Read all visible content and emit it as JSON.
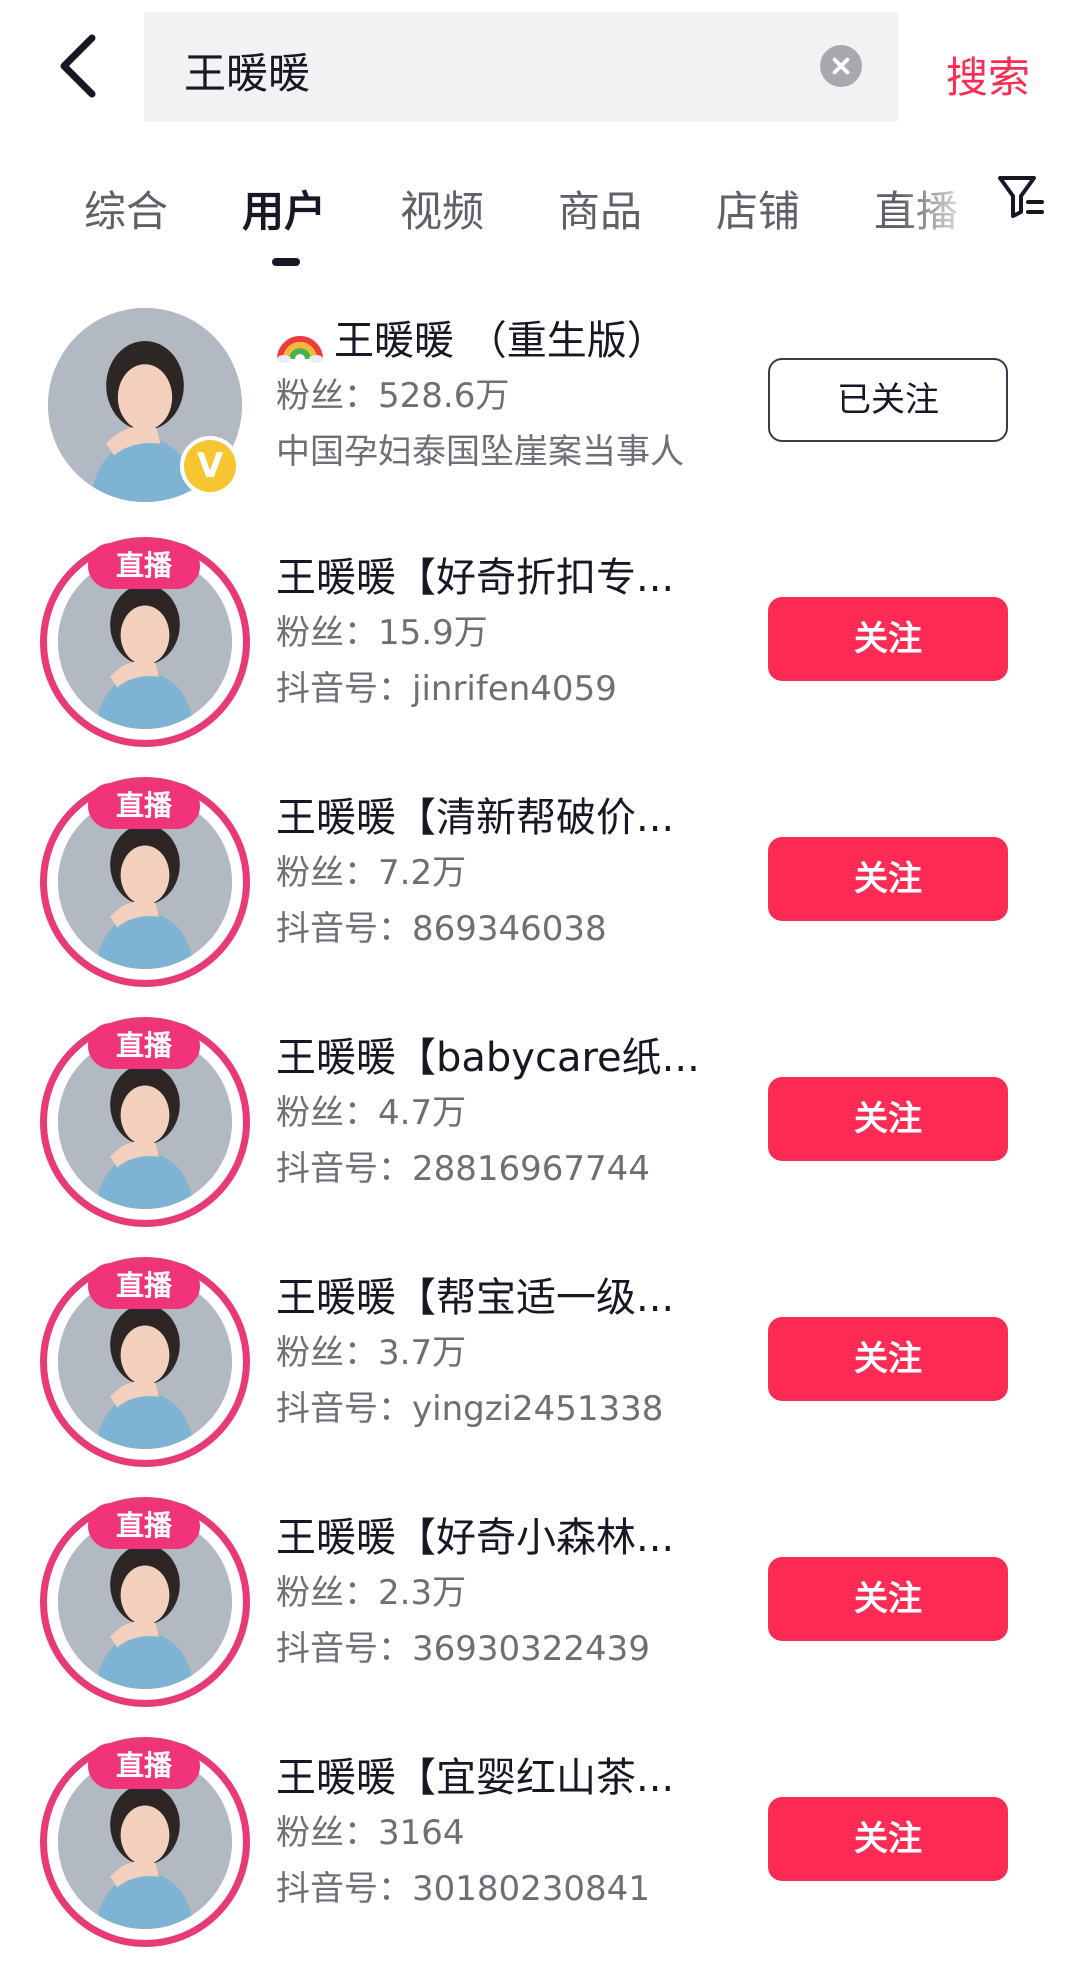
{
  "search": {
    "query": "王暖暖",
    "submit_label": "搜索"
  },
  "tabs": [
    {
      "label": "综合"
    },
    {
      "label": "用户"
    },
    {
      "label": "视频"
    },
    {
      "label": "商品"
    },
    {
      "label": "店铺"
    },
    {
      "label": "直播"
    }
  ],
  "active_tab": "用户",
  "icons": {
    "back": "chevron-left-icon",
    "clear": "clear-icon",
    "filter": "filter-icon",
    "verified": "verified-v-icon",
    "rainbow": "rainbow-emoji-icon"
  },
  "colors": {
    "accent": "#fe2c55",
    "live_ring": "#e93a78",
    "verified": "#f6c52f"
  },
  "users": [
    {
      "name": "王暖暖 （重生版）",
      "fans": "粉丝：528.6万",
      "sub": "中国孕妇泰国坠崖案当事人",
      "live_label": "",
      "verified": true,
      "button": "已关注"
    },
    {
      "name": "王暖暖【好奇折扣专...",
      "fans": "粉丝：15.9万",
      "sub": "抖音号：jinrifen4059",
      "live_label": "直播",
      "button": "关注"
    },
    {
      "name": "王暖暖【清新帮破价...",
      "fans": "粉丝：7.2万",
      "sub": "抖音号：869346038",
      "live_label": "直播",
      "button": "关注"
    },
    {
      "name": "王暖暖【babycare纸...",
      "fans": "粉丝：4.7万",
      "sub": "抖音号：28816967744",
      "live_label": "直播",
      "button": "关注"
    },
    {
      "name": "王暖暖【帮宝适一级...",
      "fans": "粉丝：3.7万",
      "sub": "抖音号：yingzi2451338",
      "live_label": "直播",
      "button": "关注"
    },
    {
      "name": "王暖暖【好奇小森林...",
      "fans": "粉丝：2.3万",
      "sub": "抖音号：36930322439",
      "live_label": "直播",
      "button": "关注"
    },
    {
      "name": "王暖暖【宜婴红山茶...",
      "fans": "粉丝：3164",
      "sub": "抖音号：30180230841",
      "live_label": "直播",
      "button": "关注"
    }
  ]
}
